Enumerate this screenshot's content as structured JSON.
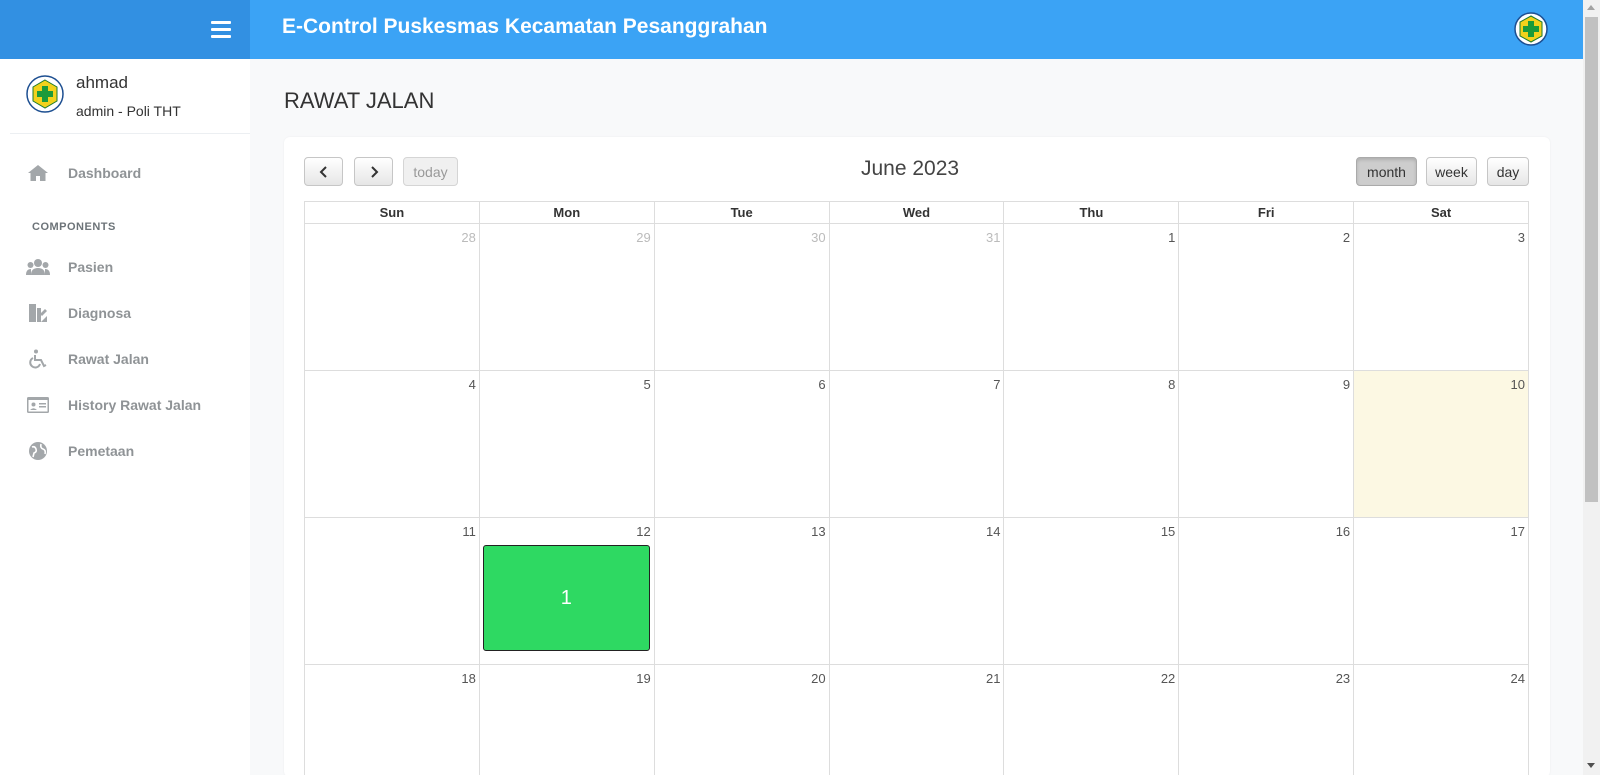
{
  "app": {
    "title": "E-Control Puskesmas Kecamatan Pesanggrahan"
  },
  "user": {
    "name": "ahmad",
    "role": "admin - Poli THT"
  },
  "sidebar": {
    "section_label": "COMPONENTS",
    "items": [
      {
        "label": "Dashboard",
        "icon": "home-icon"
      },
      {
        "label": "Pasien",
        "icon": "users-icon"
      },
      {
        "label": "Diagnosa",
        "icon": "diagnosis-icon"
      },
      {
        "label": "Rawat Jalan",
        "icon": "wheelchair-icon"
      },
      {
        "label": "History Rawat Jalan",
        "icon": "id-card-icon"
      },
      {
        "label": "Pemetaan",
        "icon": "globe-icon"
      }
    ]
  },
  "page": {
    "title": "RAWAT JALAN"
  },
  "calendar": {
    "title": "June 2023",
    "today_label": "today",
    "views": [
      "month",
      "week",
      "day"
    ],
    "active_view": "month",
    "weekdays": [
      "Sun",
      "Mon",
      "Tue",
      "Wed",
      "Thu",
      "Fri",
      "Sat"
    ],
    "weeks": [
      [
        "28",
        "29",
        "30",
        "31",
        "1",
        "2",
        "3"
      ],
      [
        "4",
        "5",
        "6",
        "7",
        "8",
        "9",
        "10"
      ],
      [
        "11",
        "12",
        "13",
        "14",
        "15",
        "16",
        "17"
      ],
      [
        "18",
        "19",
        "20",
        "21",
        "22",
        "23",
        "24"
      ]
    ],
    "today_date": "10",
    "event": {
      "date": "12",
      "label": "1",
      "color": "#2ed962"
    }
  },
  "colors": {
    "topbar": "#3ba3f5",
    "topbar_left": "#3290e2",
    "today_bg": "#fcf8e3"
  }
}
